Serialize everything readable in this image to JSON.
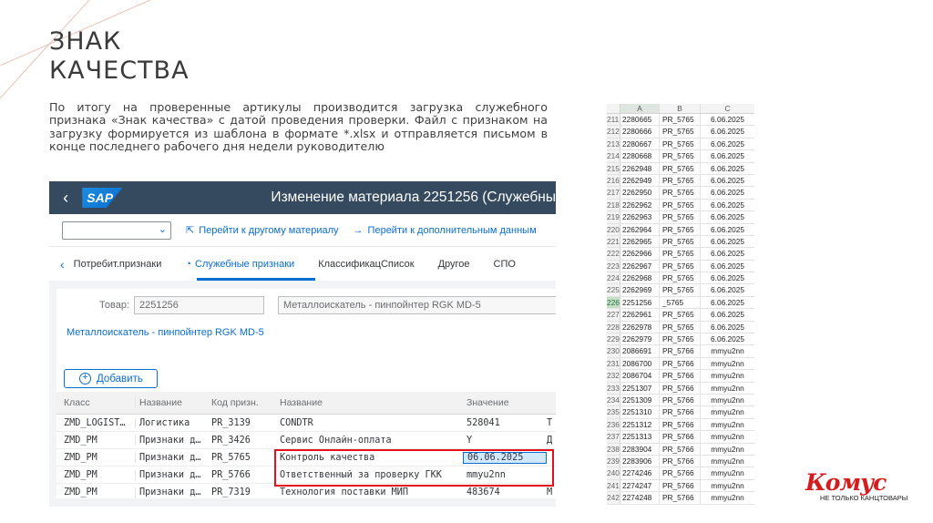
{
  "slide": {
    "title_line1": "ЗНАК",
    "title_line2": "КАЧЕСТВА",
    "description": "По итогу на проверенные артикулы производится загрузка служебного признака «Знак качества» с датой проведения проверки. Файл с признаком на загрузку формируется из шаблона в формате *.xlsx и отправляется письмом в конце последнего рабочего дня недели руководителю"
  },
  "sap": {
    "back_icon": "‹",
    "logo": "SAP",
    "title": "Изменение материала 2251256 (Служебны",
    "toolbar": {
      "select_value": "",
      "link1": "Перейти к другому материалу",
      "link2": "Перейти к дополнительным данным"
    },
    "tabs": [
      "Потребит.признаки",
      "Служебные признаки",
      "КлассификацСписок",
      "Другое",
      "СПО"
    ],
    "active_tab": "Служебные признаки",
    "product_label": "Товар:",
    "product_code": "2251256",
    "product_name": "Металлоискатель - пинпойнтер RGK MD-5",
    "material_link": "Металлоискатель - пинпойнтер RGK MD-5",
    "add_button": "Добавить",
    "table": {
      "headers": [
        "Класс",
        "Название",
        "Код призн.",
        "Название",
        "Значение"
      ],
      "rows": [
        [
          "ZMD_LOGIST…",
          "Логистика",
          "PR_3139",
          "CONDTR",
          "528041",
          "Т"
        ],
        [
          "ZMD_PM",
          "Признаки д…",
          "PR_3426",
          "Сервис Онлайн-оплата",
          "Y",
          "Д"
        ],
        [
          "ZMD_PM",
          "Признаки д…",
          "PR_5765",
          "Контроль качества",
          "06.06.2025",
          ""
        ],
        [
          "ZMD_PM",
          "Признаки д…",
          "PR_5766",
          "Ответственный за проверку ГКК",
          "mmyu2nn",
          ""
        ],
        [
          "ZMD_PM",
          "Признаки д…",
          "PR_7319",
          "Технология поставки МИП",
          "483674",
          "М"
        ]
      ]
    }
  },
  "excel": {
    "columns": [
      "A",
      "B",
      "C"
    ],
    "selected_row": "226",
    "rows": [
      [
        "211",
        "2280665",
        "PR_5765",
        "6.06.2025"
      ],
      [
        "212",
        "2280666",
        "PR_5765",
        "6.06.2025"
      ],
      [
        "213",
        "2280667",
        "PR_5765",
        "6.06.2025"
      ],
      [
        "214",
        "2280668",
        "PR_5765",
        "6.06.2025"
      ],
      [
        "215",
        "2262948",
        "PR_5765",
        "6.06.2025"
      ],
      [
        "216",
        "2262949",
        "PR_5765",
        "6.06.2025"
      ],
      [
        "217",
        "2262950",
        "PR_5765",
        "6.06.2025"
      ],
      [
        "218",
        "2262962",
        "PR_5765",
        "6.06.2025"
      ],
      [
        "219",
        "2262963",
        "PR_5765",
        "6.06.2025"
      ],
      [
        "220",
        "2262964",
        "PR_5765",
        "6.06.2025"
      ],
      [
        "221",
        "2262965",
        "PR_5765",
        "6.06.2025"
      ],
      [
        "222",
        "2262966",
        "PR_5765",
        "6.06.2025"
      ],
      [
        "223",
        "2262967",
        "PR_5765",
        "6.06.2025"
      ],
      [
        "224",
        "2262968",
        "PR_5765",
        "6.06.2025"
      ],
      [
        "225",
        "2262969",
        "PR_5765",
        "6.06.2025"
      ],
      [
        "226",
        "2251256",
        "_5765",
        "6.06.2025"
      ],
      [
        "227",
        "2262961",
        "PR_5765",
        "6.06.2025"
      ],
      [
        "228",
        "2262978",
        "PR_5765",
        "6.06.2025"
      ],
      [
        "229",
        "2262979",
        "PR_5765",
        "6.06.2025"
      ],
      [
        "230",
        "2086691",
        "PR_5766",
        "mmyu2nn"
      ],
      [
        "231",
        "2086700",
        "PR_5766",
        "mmyu2nn"
      ],
      [
        "232",
        "2086704",
        "PR_5766",
        "mmyu2nn"
      ],
      [
        "233",
        "2251307",
        "PR_5766",
        "mmyu2nn"
      ],
      [
        "234",
        "2251309",
        "PR_5766",
        "mmyu2nn"
      ],
      [
        "235",
        "2251310",
        "PR_5766",
        "mmyu2nn"
      ],
      [
        "236",
        "2251312",
        "PR_5766",
        "mmyu2nn"
      ],
      [
        "237",
        "2251313",
        "PR_5766",
        "mmyu2nn"
      ],
      [
        "238",
        "2283904",
        "PR_5766",
        "mmyu2nn"
      ],
      [
        "239",
        "2283906",
        "PR_5766",
        "mmyu2nn"
      ],
      [
        "240",
        "2274246",
        "PR_5766",
        "mmyu2nn"
      ],
      [
        "241",
        "2274247",
        "PR_5766",
        "mmyu2nn"
      ],
      [
        "242",
        "2274248",
        "PR_5766",
        "mmyu2nn"
      ]
    ]
  },
  "logo": {
    "brand": "Комус",
    "tagline": "НЕ ТОЛЬКО КАНЦТОВАРЫ"
  },
  "colors": {
    "sap_shell": "#354a5f",
    "sap_accent": "#0a6ed1",
    "highlight_box": "#e3111b",
    "brand_red": "#d51c1f"
  }
}
